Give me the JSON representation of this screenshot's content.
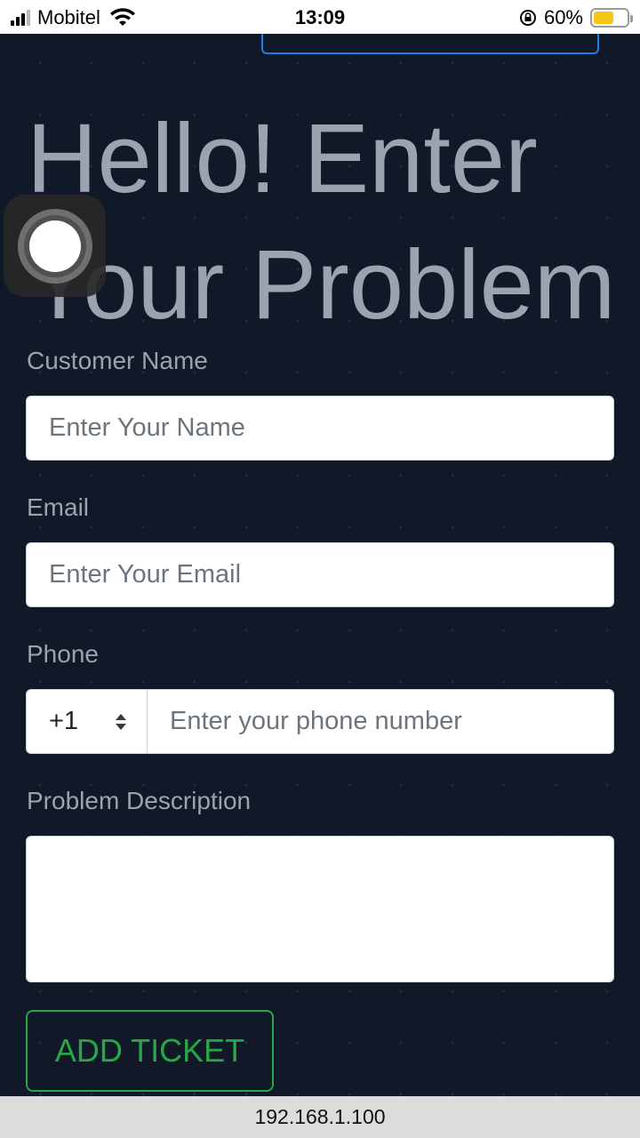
{
  "status_bar": {
    "carrier": "Mobitel",
    "time": "13:09",
    "battery_percent": "60%",
    "battery_level": 0.6
  },
  "page": {
    "headline": "Hello! Enter Your Problem"
  },
  "form": {
    "name_label": "Customer Name",
    "name_placeholder": "Enter Your Name",
    "email_label": "Email",
    "email_placeholder": "Enter Your Email",
    "phone_label": "Phone",
    "phone_code": "+1",
    "phone_placeholder": "Enter your phone number",
    "description_label": "Problem Description",
    "submit_label": "ADD TICKET"
  },
  "browser": {
    "url": "192.168.1.100"
  },
  "colors": {
    "background": "#111827",
    "accent_blue": "#1f7be6",
    "accent_green": "#28a745"
  }
}
